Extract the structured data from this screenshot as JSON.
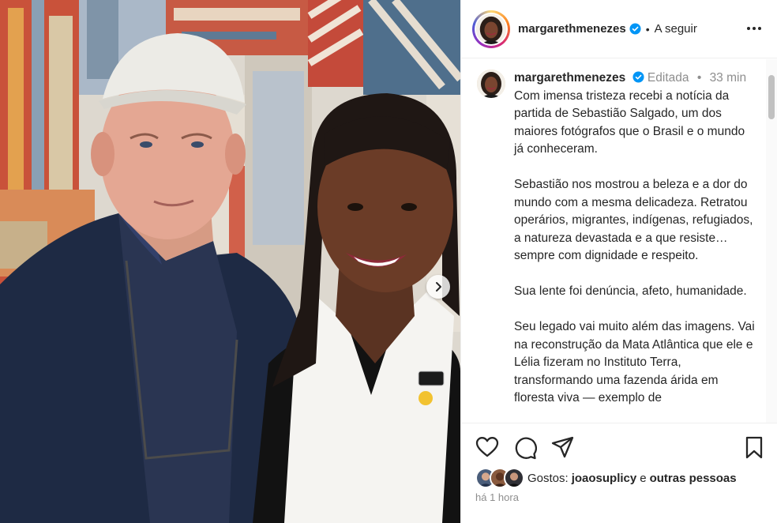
{
  "header": {
    "username": "margarethmenezes",
    "separator": "•",
    "follow_label": "A seguir"
  },
  "post": {
    "author": "margarethmenezes",
    "edited_label": "Editada",
    "meta_sep": "•",
    "time_ago": "33 min",
    "caption": "Com imensa tristeza recebi a notícia da partida de Sebastião Salgado, um dos maiores fotógrafos que o Brasil e o mundo já conheceram.\n\nSebastião nos mostrou a beleza e a dor do mundo com a mesma delicadeza. Retratou operários, migrantes, indígenas, refugiados, a natureza devastada e a que resiste… sempre com dignidade e respeito.\n\nSua lente foi denúncia, afeto, humanidade.\n\nSeu legado vai muito além das imagens. Vai na reconstrução da Mata Atlântica que ele e Lélia fizeram no Instituto Terra, transformando uma fazenda árida em floresta viva — exemplo de"
  },
  "likes": {
    "prefix": "Gostos:",
    "user": "joaosuplicy",
    "connector": "e",
    "others": "outras pessoas"
  },
  "timestamp": "há 1 hora",
  "icons": {
    "like": "heart-icon",
    "comment": "comment-icon",
    "share": "send-icon",
    "save": "bookmark-icon",
    "more": "more-dots-icon",
    "verified": "verified-badge-icon",
    "carousel": "chevron-right-icon"
  },
  "colors": {
    "verified_blue": "#0095f6",
    "text": "#262626",
    "muted": "#8e8e8e",
    "divider": "#efefef"
  }
}
